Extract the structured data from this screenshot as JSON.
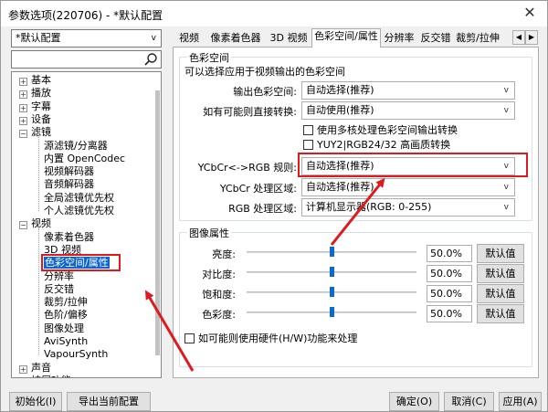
{
  "window": {
    "title": "参数选项(220706) - *默认配置",
    "close_glyph": "✕"
  },
  "left": {
    "profile_value": "*默认配置",
    "search_placeholder": "",
    "tree": [
      {
        "label": "基本",
        "level": 0,
        "expander": "+"
      },
      {
        "label": "播放",
        "level": 0,
        "expander": "+"
      },
      {
        "label": "字幕",
        "level": 0,
        "expander": "+"
      },
      {
        "label": "设备",
        "level": 0,
        "expander": "+"
      },
      {
        "label": "滤镜",
        "level": 0,
        "expander": "−"
      },
      {
        "label": "源滤镜/分离器",
        "level": 1
      },
      {
        "label": "内置 OpenCodec",
        "level": 1
      },
      {
        "label": "视频解码器",
        "level": 1
      },
      {
        "label": "音频解码器",
        "level": 1
      },
      {
        "label": "全局滤镜优先权",
        "level": 1
      },
      {
        "label": "个人滤镜优先权",
        "level": 1
      },
      {
        "label": "视频",
        "level": 0,
        "expander": "−"
      },
      {
        "label": "像素着色器",
        "level": 1
      },
      {
        "label": "3D 视频",
        "level": 1
      },
      {
        "label": "色彩空间/属性",
        "level": 1,
        "selected": true
      },
      {
        "label": "分辨率",
        "level": 1
      },
      {
        "label": "反交错",
        "level": 1
      },
      {
        "label": "裁剪/拉伸",
        "level": 1
      },
      {
        "label": "色阶/偏移",
        "level": 1
      },
      {
        "label": "图像处理",
        "level": 1
      },
      {
        "label": "AviSynth",
        "level": 1
      },
      {
        "label": "VapourSynth",
        "level": 1
      },
      {
        "label": "声音",
        "level": 0,
        "expander": "+"
      },
      {
        "label": "扩展功能",
        "level": 0,
        "expander": "+"
      }
    ]
  },
  "tabs": [
    "视频",
    "像素着色器",
    "3D 视频",
    "色彩空间/属性",
    "分辨率",
    "反交错",
    "裁剪/拉伸"
  ],
  "tab_scroll": {
    "left": "◀",
    "right": "▶"
  },
  "colorspace": {
    "group_title": "色彩空间",
    "description": "可以选择应用于视频输出的色彩空间",
    "output_label": "输出色彩空间:",
    "output_value": "自动选择(推荐)",
    "convert_label": "如有可能则直接转换:",
    "convert_value": "自动使用(推荐)",
    "check_multi_label": "使用多核处理色彩空间输出转换",
    "check_yuy2_label": "YUY2|RGB24/32 高画质转换",
    "ycbcr_rgb_label": "YCbCr<->RGB 规则:",
    "ycbcr_rgb_value": "自动选择(推荐)",
    "ycbcr_range_label": "YCbCr 处理区域:",
    "ycbcr_range_value": "自动选择(推荐)",
    "rgb_range_label": "RGB 处理区域:",
    "rgb_range_value": "计算机显示器(RGB: 0-255)",
    "dropdown_arrow": "v"
  },
  "image_props": {
    "group_title": "图像属性",
    "default_label": "默认值",
    "rows": [
      {
        "label": "亮度:",
        "value": "50.0%",
        "level": 0.5
      },
      {
        "label": "对比度:",
        "value": "50.0%",
        "level": 0.5
      },
      {
        "label": "饱和度:",
        "value": "50.0%",
        "level": 0.5
      },
      {
        "label": "色彩度:",
        "value": "50.0%",
        "level": 0.5
      }
    ],
    "hw_label": "如可能则使用硬件(H/W)功能来处理"
  },
  "bottom": {
    "init": "初始化(I)",
    "export": "导出当前配置(S)...",
    "ok": "确定(O)",
    "cancel": "取消(C)",
    "apply": "应用(A)"
  },
  "colors": {
    "selection": "#0a64d2",
    "highlight": "#e0191f",
    "slider_thumb": "#0a6ad1"
  }
}
